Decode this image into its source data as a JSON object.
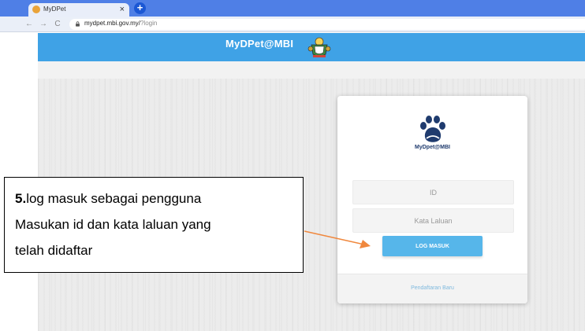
{
  "browser": {
    "tab_title": "MyDPet",
    "tab_close": "×",
    "new_tab": "+",
    "back": "←",
    "forward": "→",
    "reload": "C",
    "url_host": "mydpet.mbi.gov.my/",
    "url_path": "?login"
  },
  "header": {
    "brand": "MyDPet@MBI",
    "color": "#3fa2e6"
  },
  "login": {
    "card_brand": "MyDpet@MBI",
    "id_placeholder": "ID",
    "password_placeholder": "Kata Laluan",
    "login_button": "LOG MASUK",
    "register_link": "Pendaftaran Baru",
    "button_color": "#56b6ea"
  },
  "annotation": {
    "step_number": "5.",
    "line1": "log masuk sebagai pengguna",
    "line2": "Masukan id dan kata laluan yang",
    "line3": "telah didaftar",
    "arrow_color": "#f0883e"
  },
  "icons": {
    "favicon": "crest-favicon-icon",
    "lock": "lock-icon",
    "crest": "mbi-crest-icon",
    "logo": "paw-logo-icon",
    "arrow": "arrow-right-icon"
  }
}
